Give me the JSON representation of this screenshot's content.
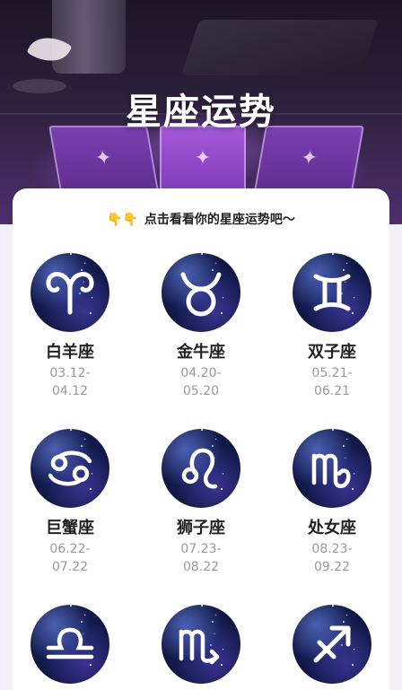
{
  "header": {
    "title": "星座运势"
  },
  "hint": {
    "emoji": "👇👇",
    "text": "点击看看你的星座运势吧～"
  },
  "signs": [
    {
      "name": "白羊座",
      "date_start": "03.12-",
      "date_end": "04.12",
      "icon": "aries-icon"
    },
    {
      "name": "金牛座",
      "date_start": "04.20-",
      "date_end": "05.20",
      "icon": "taurus-icon"
    },
    {
      "name": "双子座",
      "date_start": "05.21-",
      "date_end": "06.21",
      "icon": "gemini-icon"
    },
    {
      "name": "巨蟹座",
      "date_start": "06.22-",
      "date_end": "07.22",
      "icon": "cancer-icon"
    },
    {
      "name": "狮子座",
      "date_start": "07.23-",
      "date_end": "08.22",
      "icon": "leo-icon"
    },
    {
      "name": "处女座",
      "date_start": "08.23-",
      "date_end": "09.22",
      "icon": "virgo-icon"
    },
    {
      "name": "",
      "date_start": "",
      "date_end": "",
      "icon": "libra-icon"
    },
    {
      "name": "",
      "date_start": "",
      "date_end": "",
      "icon": "scorpio-icon"
    },
    {
      "name": "",
      "date_start": "",
      "date_end": "",
      "icon": "sagittarius-icon"
    }
  ],
  "colors": {
    "panel": "#ffffff",
    "title": "#ffffff",
    "sign_name": "#222222",
    "sign_dates": "#9a9a9a",
    "medallion": "#121a4a"
  }
}
